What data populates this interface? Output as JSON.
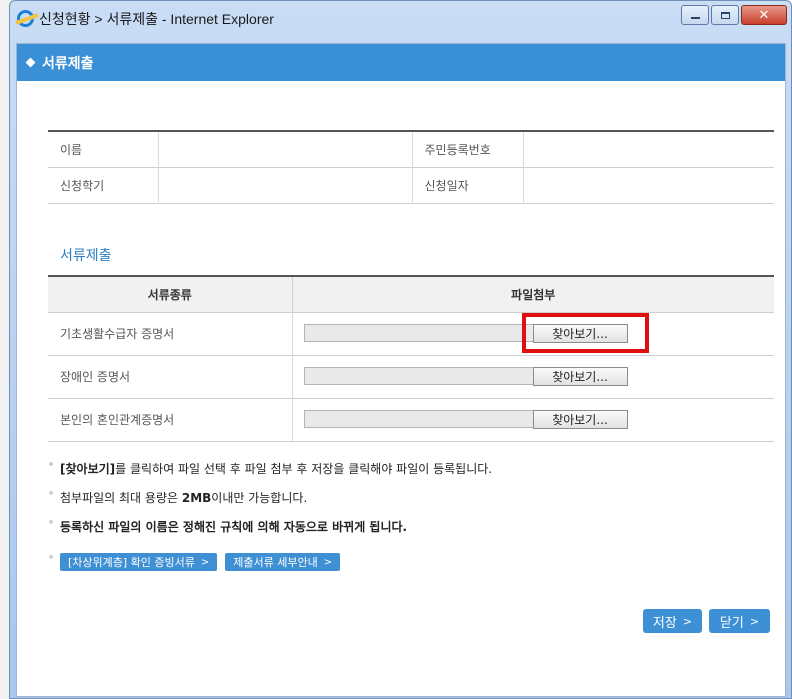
{
  "window": {
    "title": "신청현황 > 서류제출 - Internet Explorer",
    "close_glyph": "✕"
  },
  "header": {
    "title": "서류제출"
  },
  "info": {
    "name_label": "이름",
    "name_value": "",
    "rrn_label": "주민등록번호",
    "rrn_value": "",
    "semester_label": "신청학기",
    "semester_value": "",
    "date_label": "신청일자",
    "date_value": ""
  },
  "docs_section": {
    "title": "서류제출",
    "col_type": "서류종류",
    "col_file": "파일첨부",
    "rows": [
      {
        "name": "기초생활수급자 증명서",
        "file": "",
        "button": "찾아보기..."
      },
      {
        "name": "장애인 증명서",
        "file": "",
        "button": "찾아보기..."
      },
      {
        "name": "본인의 혼인관계증명서",
        "file": "",
        "button": "찾아보기..."
      }
    ]
  },
  "notes": {
    "n1_bold": "[찾아보기]",
    "n1_rest": "를 클릭하여 파일 선택 후 파일 첨부 후 저장을 클릭해야 파일이 등록됩니다.",
    "n2_pre": "첨부파일의 최대 용량은 ",
    "n2_bold": "2MB",
    "n2_post": "이내만 가능합니다.",
    "n3": "등록하신 파일의 이름은 정해진 규칙에 의해 자동으로 바뀌게 됩니다."
  },
  "links": {
    "evidence": "[차상위계층] 확인 증빙서류",
    "guide": "제출서류 세부안내"
  },
  "actions": {
    "save": "저장",
    "close": "닫기",
    "chevron": ">"
  },
  "colors": {
    "header_blue": "#3a90d6",
    "highlight_red": "#e01010"
  }
}
